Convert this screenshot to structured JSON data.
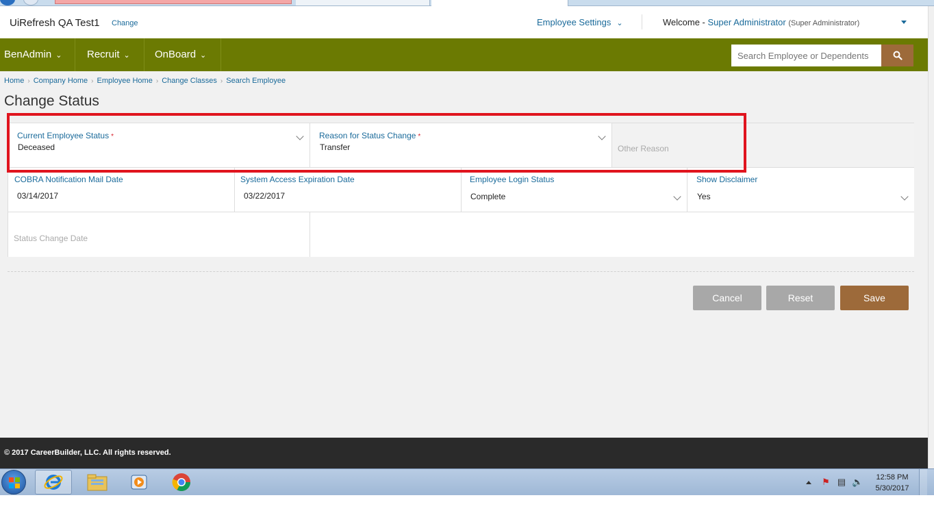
{
  "header": {
    "company": "UiRefresh QA Test1",
    "change_link": "Change",
    "employee_settings": "Employee Settings",
    "welcome_label": "Welcome -",
    "user_name": "Super Administrator",
    "user_role": "(Super Administrator)"
  },
  "nav": {
    "items": [
      {
        "label": "BenAdmin"
      },
      {
        "label": "Recruit"
      },
      {
        "label": "OnBoard"
      }
    ],
    "search_placeholder": "Search Employee or Dependents"
  },
  "breadcrumb": [
    "Home",
    "Company Home",
    "Employee Home",
    "Change Classes",
    "Search Employee"
  ],
  "page_title": "Change Status",
  "form": {
    "current_status": {
      "label": "Current Employee Status",
      "required": "*",
      "value": "Deceased"
    },
    "reason": {
      "label": "Reason for Status Change",
      "required": "*",
      "value": "Transfer"
    },
    "other_reason": {
      "placeholder": "Other Reason"
    },
    "cobra_date": {
      "label": "COBRA Notification Mail Date",
      "value": "03/14/2017"
    },
    "system_access": {
      "label": "System Access Expiration Date",
      "value": "03/22/2017"
    },
    "login_status": {
      "label": "Employee Login Status",
      "value": "Complete"
    },
    "show_disclaimer": {
      "label": "Show Disclaimer",
      "value": "Yes"
    },
    "status_change_date": {
      "placeholder": "Status Change Date"
    }
  },
  "buttons": {
    "cancel": "Cancel",
    "reset": "Reset",
    "save": "Save"
  },
  "footer": {
    "copyright": "© 2017 CareerBuilder, LLC. All rights reserved."
  },
  "taskbar": {
    "time": "12:58 PM",
    "date": "5/30/2017"
  },
  "colors": {
    "nav_green": "#6b7a02",
    "accent_brown": "#9d6a3a",
    "link_blue": "#1a6a9a",
    "highlight_red": "#e0141e"
  }
}
